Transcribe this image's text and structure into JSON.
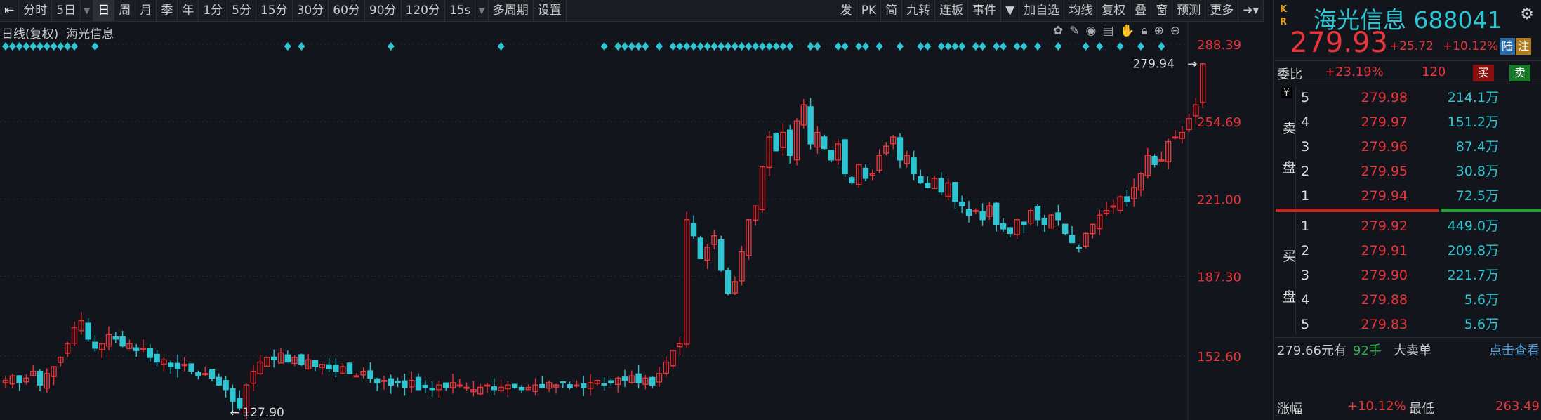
{
  "toolbar": {
    "items": [
      "分时",
      "5日",
      "日",
      "周",
      "月",
      "季",
      "年",
      "1分",
      "5分",
      "15分",
      "30分",
      "60分",
      "90分",
      "120分",
      "15s",
      "多周期",
      "设置"
    ],
    "active": "日",
    "right_items": [
      "发",
      "PK",
      "简",
      "九转",
      "连板",
      "事件",
      "加自选",
      "均线",
      "复权",
      "叠",
      "窗",
      "预测",
      "更多"
    ]
  },
  "subhead": {
    "mode": "日线(复权)",
    "name": "海光信息"
  },
  "quote": {
    "name_code": "海光信息 688041",
    "price": "279.93",
    "change": "+25.72",
    "change_pct": "+10.12%",
    "badge1": "陆",
    "badge2": "注",
    "kr": "K R",
    "weibi_label": "委比",
    "weibi": "+23.19%",
    "weicha": "120",
    "buy": "买",
    "sell": "卖"
  },
  "orderbook": {
    "sell_label": [
      "卖",
      "盘"
    ],
    "buy_label": [
      "买",
      "盘"
    ],
    "currency": "¥",
    "asks": [
      {
        "lvl": "5",
        "price": "279.98",
        "vol": "214.1万"
      },
      {
        "lvl": "4",
        "price": "279.97",
        "vol": "151.2万"
      },
      {
        "lvl": "3",
        "price": "279.96",
        "vol": "87.4万"
      },
      {
        "lvl": "2",
        "price": "279.95",
        "vol": "30.8万"
      },
      {
        "lvl": "1",
        "price": "279.94",
        "vol": "72.5万"
      }
    ],
    "bids": [
      {
        "lvl": "1",
        "price": "279.92",
        "vol": "449.0万"
      },
      {
        "lvl": "2",
        "price": "279.91",
        "vol": "209.8万"
      },
      {
        "lvl": "3",
        "price": "279.90",
        "vol": "221.7万"
      },
      {
        "lvl": "4",
        "price": "279.88",
        "vol": "5.6万"
      },
      {
        "lvl": "5",
        "price": "279.83",
        "vol": "5.6万"
      }
    ]
  },
  "big_order": {
    "price": "279.66元有",
    "qty": "92手",
    "type": "大卖单",
    "link": "点击查看"
  },
  "bottom": {
    "label1": "涨幅",
    "val1": "+10.12%",
    "label2": "最低",
    "val2": "263.49"
  },
  "colors": {
    "up": "#e8343a",
    "down": "#2ec5d3",
    "bg": "#12151b",
    "signal": "#2ec5d3"
  },
  "chart_data": {
    "type": "candlestick",
    "title": "日线(复权) 海光信息",
    "y_ticks": [
      "288.39",
      "254.69",
      "221.00",
      "187.30",
      "152.60"
    ],
    "ylim": [
      119,
      300
    ],
    "max_label": "279.94",
    "min_label": "127.90",
    "min_index": 33,
    "close": [
      142,
      144,
      141,
      143,
      146,
      140,
      145,
      148,
      152,
      158,
      165,
      168,
      160,
      156,
      158,
      162,
      160,
      157,
      158,
      155,
      156,
      152,
      150,
      151,
      148,
      147,
      149,
      146,
      144,
      145,
      143,
      140,
      138,
      133,
      130,
      140,
      146,
      150,
      152,
      151,
      154,
      150,
      152,
      149,
      151,
      148,
      149,
      147,
      146,
      148,
      145,
      144,
      146,
      143,
      141,
      142,
      140,
      141,
      139,
      142,
      138,
      139,
      138,
      140,
      139,
      141,
      140,
      139,
      138,
      139,
      140,
      138,
      139,
      140,
      139,
      138,
      139,
      140,
      139,
      141,
      140,
      141,
      139,
      140,
      139,
      141,
      142,
      140,
      141,
      143,
      142,
      144,
      141,
      143,
      140,
      145,
      150,
      155,
      158,
      212,
      205,
      195,
      200,
      205,
      190,
      180,
      185,
      198,
      212,
      218,
      235,
      248,
      242,
      250,
      240,
      255,
      262,
      245,
      250,
      243,
      238,
      245,
      232,
      228,
      236,
      230,
      232,
      240,
      244,
      248,
      238,
      240,
      232,
      228,
      226,
      230,
      224,
      228,
      220,
      218,
      214,
      216,
      212,
      218,
      210,
      208,
      206,
      212,
      210,
      216,
      212,
      210,
      214,
      212,
      206,
      202,
      200,
      206,
      210,
      214,
      216,
      218,
      222,
      220,
      226,
      232,
      240,
      236,
      238,
      246,
      248,
      250,
      256,
      262,
      279.93
    ],
    "signal_indices": [
      0,
      1,
      2,
      3,
      4,
      5,
      6,
      7,
      8,
      9,
      10,
      13,
      41,
      43,
      56,
      72,
      87,
      89,
      90,
      91,
      92,
      93,
      95,
      97,
      98,
      99,
      100,
      101,
      102,
      103,
      104,
      105,
      106,
      107,
      108,
      109,
      110,
      111,
      112,
      113,
      114,
      117,
      118,
      121,
      122,
      124,
      125,
      127,
      130,
      133,
      134,
      136,
      137,
      138,
      139,
      141,
      142,
      144,
      145,
      147,
      148,
      150,
      153,
      157,
      159,
      162,
      165,
      168
    ]
  }
}
